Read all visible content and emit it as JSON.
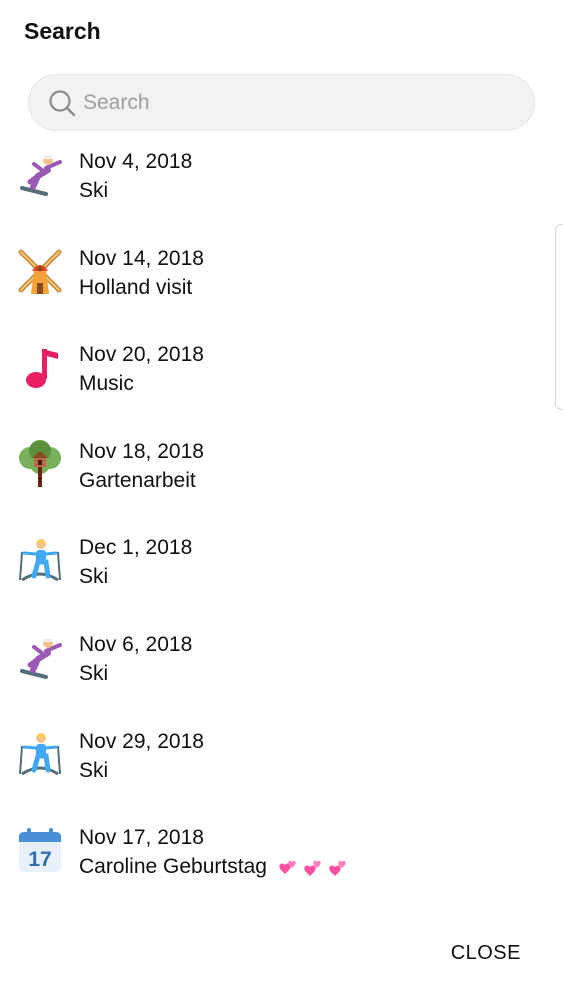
{
  "dialog": {
    "title": "Search",
    "search": {
      "placeholder": "Search",
      "value": ""
    },
    "results": [
      {
        "date": "Nov 4, 2018",
        "label": "Ski",
        "icon": "snowboarder-icon"
      },
      {
        "date": "Nov 14, 2018",
        "label": "Holland visit",
        "icon": "windmill-icon"
      },
      {
        "date": "Nov 20, 2018",
        "label": "Music",
        "icon": "music-note-icon"
      },
      {
        "date": "Nov 18, 2018",
        "label": "Gartenarbeit",
        "icon": "treehouse-icon"
      },
      {
        "date": "Dec 1, 2018",
        "label": "Ski",
        "icon": "skier-icon"
      },
      {
        "date": "Nov 6, 2018",
        "label": "Ski",
        "icon": "snowboarder-icon"
      },
      {
        "date": "Nov 29, 2018",
        "label": "Ski",
        "icon": "skier-icon"
      },
      {
        "date": "Nov 17, 2018",
        "label": "Caroline Geburtstag",
        "icon": "calendar-icon",
        "calendar_day": "17",
        "suffix_icon": "hearts-icon"
      }
    ],
    "close_label": "CLOSE"
  },
  "colors": {
    "music": "#e91e63",
    "calendar": "#4a90d9",
    "hearts": "#ff4fa3",
    "snowboarder_outfit": "#9b59b6",
    "skier_outfit": "#3fa9f5"
  }
}
